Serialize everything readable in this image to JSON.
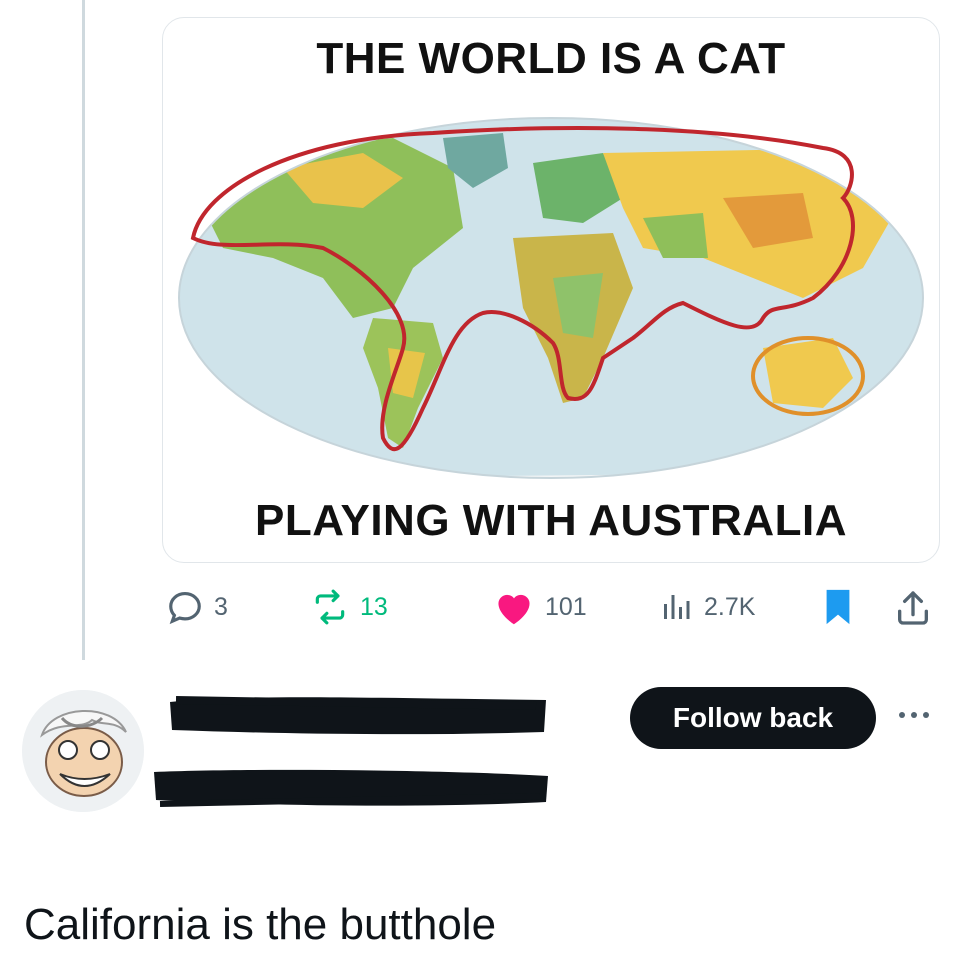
{
  "meme": {
    "top_text": "THE WORLD IS A CAT",
    "bottom_text": "PLAYING WITH AUSTRALIA"
  },
  "actions": {
    "replies": "3",
    "retweets": "13",
    "likes": "101",
    "views": "2.7K"
  },
  "colors": {
    "retweet": "#00ba7c",
    "like": "#f91880",
    "bookmark": "#1d9bf0",
    "button_bg": "#0f1419",
    "cat_outline": "#c0262d",
    "australia_outline": "#e0902a"
  },
  "reply": {
    "follow_label": "Follow back",
    "text": "California is the butthole"
  },
  "icons": [
    "reply-icon",
    "retweet-icon",
    "heart-icon",
    "views-icon",
    "bookmark-icon",
    "share-icon",
    "more-icon"
  ]
}
